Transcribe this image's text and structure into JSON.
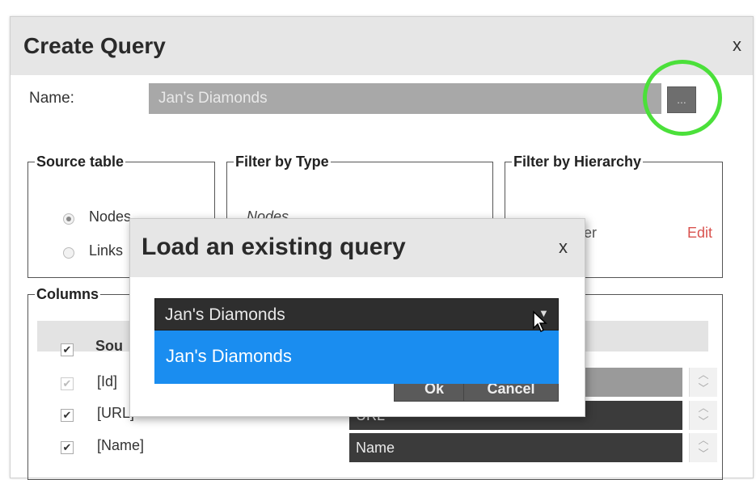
{
  "main_dialog": {
    "title": "Create Query",
    "close_label": "x",
    "name_label": "Name:",
    "name_value": "Jan's Diamonds",
    "browse_label": "..."
  },
  "source_table": {
    "legend": "Source table",
    "options": [
      {
        "label": "Nodes",
        "selected": true
      },
      {
        "label": "Links",
        "selected": false
      }
    ]
  },
  "filter_by_type": {
    "legend": "Filter by Type",
    "value": "Nodes"
  },
  "filter_by_hierarchy": {
    "legend": "Filter by Hierarchy",
    "value_partial": "er",
    "edit_label": "Edit"
  },
  "columns": {
    "legend": "Columns",
    "header_label": "Sou",
    "rows": [
      {
        "label": "[Id]",
        "value": "",
        "checked": true,
        "disabled": true
      },
      {
        "label": "[URL]",
        "value": "URL",
        "checked": true,
        "disabled": false
      },
      {
        "label": "[Name]",
        "value": "Name",
        "checked": true,
        "disabled": false
      }
    ]
  },
  "load_dialog": {
    "title": "Load an existing query",
    "close_label": "x",
    "selected_value": "Jan's Diamonds",
    "options": [
      "Jan's Diamonds"
    ],
    "ok_label": "Ok",
    "cancel_label": "Cancel"
  },
  "colors": {
    "highlight": "#4be03a",
    "dropdown_selected": "#1a8df0",
    "edit_link": "#d9534f"
  }
}
